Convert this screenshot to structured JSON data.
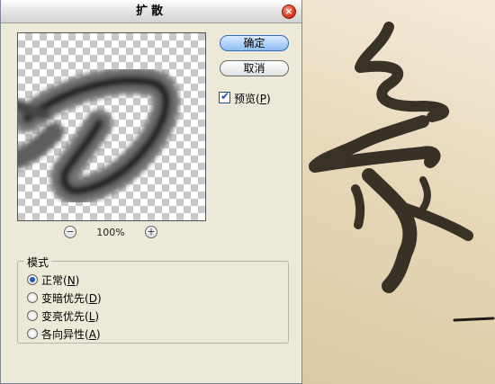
{
  "dialog": {
    "title": "扩散",
    "close_icon": "close-icon"
  },
  "preview": {
    "zoom_level": "100%",
    "zoom_out_symbol": "−",
    "zoom_in_symbol": "+"
  },
  "buttons": {
    "ok_label": "确定",
    "cancel_label": "取消"
  },
  "preview_toggle": {
    "checked": true,
    "label_prefix": "预览(",
    "label_key": "P",
    "label_suffix": ")"
  },
  "mode": {
    "legend": "模式",
    "options": [
      {
        "prefix": "正常(",
        "key": "N",
        "suffix": ")",
        "selected": true
      },
      {
        "prefix": "变暗优先(",
        "key": "D",
        "suffix": ")",
        "selected": false
      },
      {
        "prefix": "变亮优先(",
        "key": "L",
        "suffix": ")",
        "selected": false
      },
      {
        "prefix": "各向异性(",
        "key": "A",
        "suffix": ")",
        "selected": false
      }
    ]
  }
}
